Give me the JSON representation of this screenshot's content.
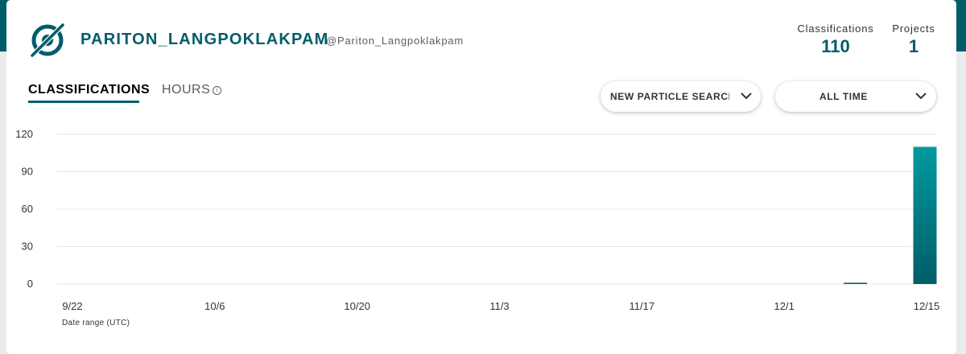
{
  "profile": {
    "username": "PARITON_LANGPOKLAKPAM",
    "handle": "@Pariton_Langpoklakpam",
    "logo_icon": "zooniverse-logo-icon"
  },
  "stats": {
    "classifications_label": "Classifications",
    "classifications_value": "110",
    "projects_label": "Projects",
    "projects_value": "1"
  },
  "tabs": {
    "classifications": "CLASSIFICATIONS",
    "hours": "HOURS",
    "info_icon": "info-icon"
  },
  "filters": {
    "project": "NEW PARTICLE SEARCH AT CERN",
    "range": "ALL TIME"
  },
  "colors": {
    "brand": "#005d69",
    "bar_top": "#009a9e",
    "bar_bottom": "#005d69"
  },
  "chart_data": {
    "type": "bar",
    "ylim": [
      0,
      120
    ],
    "yticks": [
      "0",
      "30",
      "60",
      "90",
      "120"
    ],
    "xticks": [
      "9/22",
      "10/6",
      "10/20",
      "11/3",
      "11/17",
      "12/1",
      "12/15"
    ],
    "x_start": "9/22",
    "x_end": "12/15",
    "bars": [
      {
        "week": "12/8",
        "value": 1
      },
      {
        "week": "12/15",
        "value": 110
      }
    ],
    "xlabel": "Date range (UTC)",
    "grid": true
  }
}
